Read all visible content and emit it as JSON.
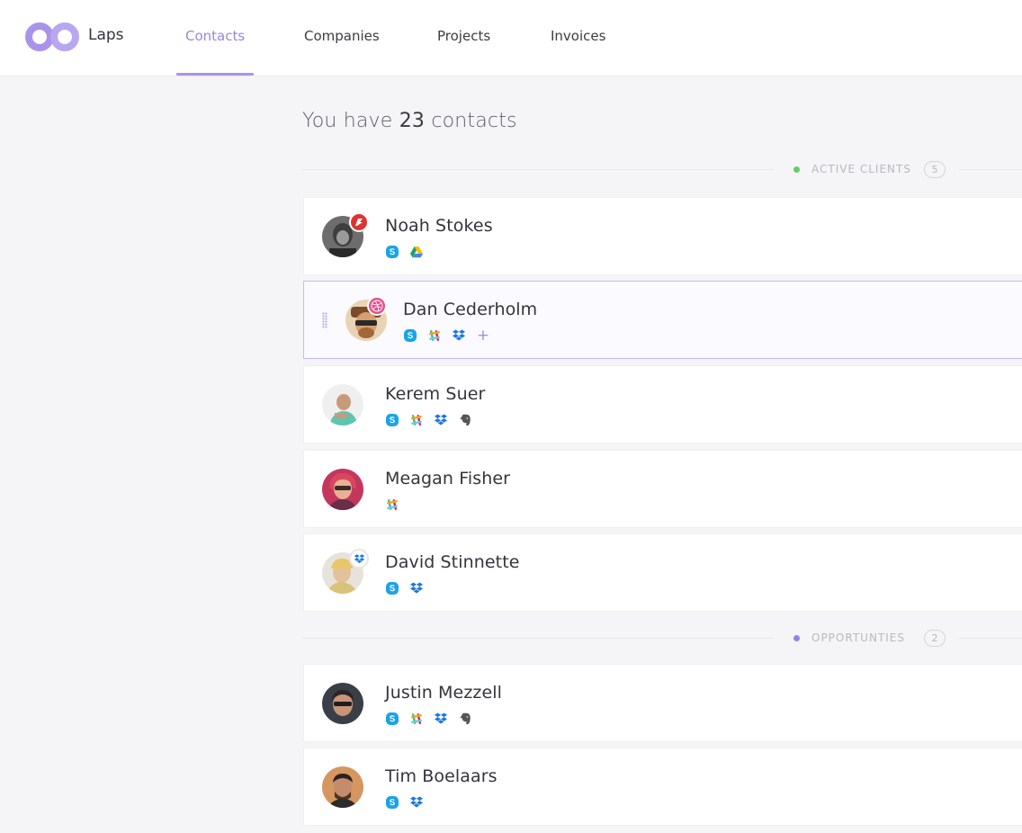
{
  "app": {
    "name": "Laps"
  },
  "nav": {
    "tabs": [
      {
        "label": "Contacts",
        "active": true
      },
      {
        "label": "Companies",
        "active": false
      },
      {
        "label": "Projects",
        "active": false
      },
      {
        "label": "Invoices",
        "active": false
      }
    ]
  },
  "main": {
    "title_prefix": "You have",
    "contact_count": "23",
    "title_suffix": "contacts",
    "sections": [
      {
        "label": "ACTIVE CLIENTS",
        "count": "5",
        "dot_color": "#5fd16a",
        "contacts": [
          {
            "name": "Noah Stokes",
            "apps": [
              "skype-icon",
              "google-drive-icon"
            ],
            "badge": "brand-badge-red"
          },
          {
            "name": "Dan Cederholm",
            "apps": [
              "skype-icon",
              "slack-icon",
              "dropbox-icon"
            ],
            "badge": "dribbble-badge",
            "selected": true,
            "add_label": "+"
          },
          {
            "name": "Kerem Suer",
            "apps": [
              "skype-icon",
              "slack-icon",
              "dropbox-icon",
              "evernote-icon"
            ]
          },
          {
            "name": "Meagan Fisher",
            "apps": [
              "slack-icon"
            ]
          },
          {
            "name": "David Stinnette",
            "apps": [
              "skype-icon",
              "dropbox-icon"
            ],
            "badge": "dropbox-badge"
          }
        ]
      },
      {
        "label": "OPPORTUNTIES",
        "count": "2",
        "dot_color": "#9b7ee8",
        "contacts": [
          {
            "name": "Justin Mezzell",
            "apps": [
              "skype-icon",
              "slack-icon",
              "dropbox-icon",
              "evernote-icon"
            ]
          },
          {
            "name": "Tim Boelaars",
            "apps": [
              "skype-icon",
              "dropbox-icon"
            ]
          }
        ]
      }
    ]
  },
  "colors": {
    "accent": "#a994ea",
    "skype": "#1aa3e8",
    "dropbox": "#1b78e2",
    "evernote": "#555555"
  }
}
